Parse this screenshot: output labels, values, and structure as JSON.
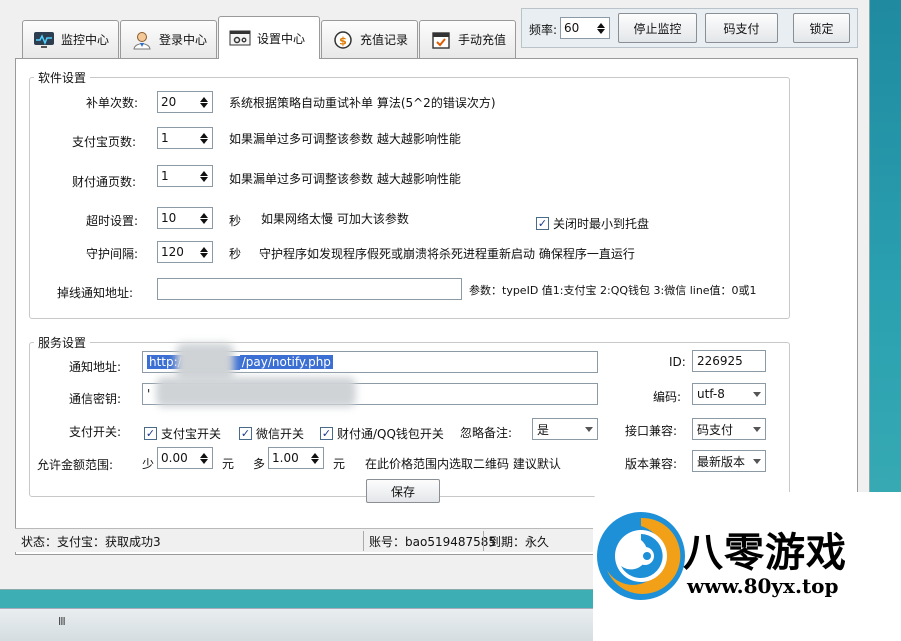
{
  "tabs": [
    {
      "label": "监控中心",
      "icon": "monitor-icon"
    },
    {
      "label": "登录中心",
      "icon": "user-icon"
    },
    {
      "label": "设置中心",
      "icon": "settings-icon",
      "active": true
    },
    {
      "label": "充值记录",
      "icon": "coin-icon"
    },
    {
      "label": "手动充值",
      "icon": "calendar-icon"
    }
  ],
  "toolbar": {
    "freq_label": "频率:",
    "freq_value": "60",
    "stop_label": "停止监控",
    "codepay_label": "码支付",
    "lock_label": "锁定"
  },
  "software": {
    "title": "软件设置",
    "retry_label": "补单次数:",
    "retry_value": "20",
    "retry_desc": "系统根据策略自动重试补单 算法(5^2的错误次方)",
    "alipay_label": "支付宝页数:",
    "alipay_value": "1",
    "alipay_desc": "如果漏单过多可调整该参数 越大越影响性能",
    "tenpay_label": "财付通页数:",
    "tenpay_value": "1",
    "tenpay_desc": "如果漏单过多可调整该参数 越大越影响性能",
    "timeout_label": "超时设置:",
    "timeout_value": "10",
    "timeout_unit": "秒",
    "timeout_desc": "如果网络太慢 可加大该参数",
    "tray_label": "关闭时最小到托盘",
    "guard_label": "守护间隔:",
    "guard_value": "120",
    "guard_unit": "秒",
    "guard_desc": "守护程序如发现程序假死或崩溃将杀死进程重新启动 确保程序一直运行",
    "notify_label": "掉线通知地址:",
    "notify_value": "",
    "notify_desc": "参数：typeID 值1:支付宝 2:QQ钱包 3:微信  line值：0或1"
  },
  "service": {
    "title": "服务设置",
    "url_label": "通知地址:",
    "url_prefix": "http:/",
    "url_suffix": "/pay/notify.php",
    "id_label": "ID:",
    "id_value": "226925",
    "key_label": "通信密钥:",
    "key_value": "'",
    "encoding_label": "编码:",
    "encoding_value": "utf-8",
    "switch_label": "支付开关:",
    "alipay_switch": "支付宝开关",
    "wechat_switch": "微信开关",
    "tenpay_switch": "财付通/QQ钱包开关",
    "ignore_label": "忽略备注:",
    "ignore_value": "是",
    "compat_label": "接口兼容:",
    "compat_value": "码支付",
    "range_label": "允许金额范围:",
    "min_label": "少",
    "min_value": "0.00",
    "min_unit": "元",
    "max_label": "多",
    "max_value": "1.00",
    "max_unit": "元",
    "range_desc": "在此价格范围内选取二维码 建议默认",
    "version_label": "版本兼容:",
    "version_value": "最新版本",
    "save_label": "保存"
  },
  "status": {
    "state": "状态：支付宝：获取成功3",
    "account": "账号：bao519487585",
    "expire": "到期：永久"
  },
  "taskbar": {
    "grip": "III"
  },
  "badge": {
    "title": "八零游戏",
    "url": "www.80yx.top"
  },
  "colors": {
    "accent": "#3b6fd4",
    "background": "#2aa0b0",
    "logo_blue": "#1e90d8",
    "logo_orange": "#f2a017"
  }
}
